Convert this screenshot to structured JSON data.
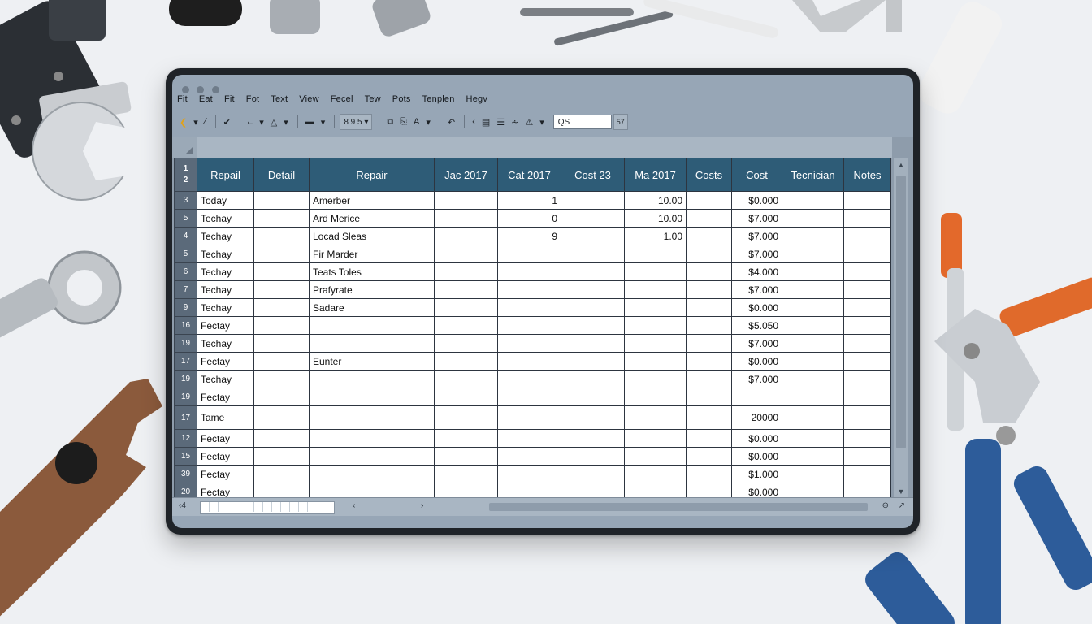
{
  "menu": [
    "Fit",
    "Eat",
    "Fit",
    "Fot",
    "Text",
    "View",
    "Fecel",
    "Tew",
    "Pots",
    "Tenplen",
    "Hegv"
  ],
  "toolbar": {
    "zoom": "8 9 5",
    "name_box": "QS",
    "fx": "57"
  },
  "sheet": {
    "header_row_numbers": [
      "1",
      "2"
    ],
    "columns": [
      "Repail",
      "Detail",
      "Repair",
      "Jac 2017",
      "Cat 2017",
      "Cost 23",
      "Ma 2017",
      "Costs",
      "Cost",
      "Tecnician",
      "Notes"
    ],
    "rows": [
      {
        "rn": "3",
        "a": "Today",
        "c": "Amerber",
        "e": "1",
        "g": "10.00",
        "i": "$0.000"
      },
      {
        "rn": "5",
        "a": "Techay",
        "c": "Ard Merice",
        "e": "0",
        "g": "10.00",
        "i": "$7.000"
      },
      {
        "rn": "4",
        "a": "Techay",
        "c": "Locad Sleas",
        "e": "9",
        "g": "1.00",
        "i": "$7.000"
      },
      {
        "rn": "5",
        "a": "Techay",
        "c": "Fir Marder",
        "e": "",
        "g": "",
        "i": "$7.000"
      },
      {
        "rn": "6",
        "a": "Techay",
        "c": "Teats Toles",
        "e": "",
        "g": "",
        "i": "$4.000"
      },
      {
        "rn": "7",
        "a": "Techay",
        "c": "Prafyrate",
        "e": "",
        "g": "",
        "i": "$7.000"
      },
      {
        "rn": "9",
        "a": "Techay",
        "c": "Sadare",
        "e": "",
        "g": "",
        "i": "$0.000"
      },
      {
        "rn": "16",
        "a": "Fectay",
        "c": "",
        "e": "",
        "g": "",
        "i": "$5.050"
      },
      {
        "rn": "19",
        "a": "Techay",
        "c": "",
        "e": "",
        "g": "",
        "i": "$7.000"
      },
      {
        "rn": "17",
        "a": "Fectay",
        "c": "Eunter",
        "e": "",
        "g": "",
        "i": "$0.000"
      },
      {
        "rn": "19",
        "a": "Techay",
        "c": "",
        "e": "",
        "g": "",
        "i": "$7.000"
      },
      {
        "rn": "19",
        "a": "Fectay",
        "c": "",
        "e": "",
        "g": "",
        "i": ""
      },
      {
        "rn": "17",
        "a": "Tame",
        "c": "",
        "e": "",
        "g": "",
        "i": "20000"
      },
      {
        "rn": "12",
        "a": "Fectay",
        "c": "",
        "e": "",
        "g": "",
        "i": "$0.000"
      },
      {
        "rn": "15",
        "a": "Fectay",
        "c": "",
        "e": "",
        "g": "",
        "i": "$0.000"
      },
      {
        "rn": "39",
        "a": "Fectay",
        "c": "",
        "e": "",
        "g": "",
        "i": "$1.000"
      },
      {
        "rn": "20",
        "a": "Fectay",
        "c": "",
        "e": "",
        "g": "",
        "i": "$0.000"
      }
    ]
  },
  "colors": {
    "header_bg": "#2e5c77",
    "screen_bg": "#97a6b6",
    "frame": "#1f2328"
  },
  "icons": [
    "undo-icon",
    "pen-icon",
    "check-icon",
    "chart-icon",
    "fill-icon",
    "border-icon",
    "link-icon",
    "copy-icon",
    "font-icon",
    "redo-icon",
    "table-icon",
    "align-icon",
    "format-icon",
    "warning-icon"
  ]
}
